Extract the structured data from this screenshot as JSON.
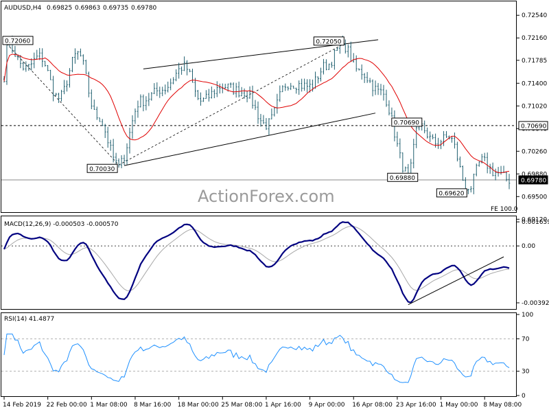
{
  "chart_data": [
    {
      "type": "candlestick",
      "title": "AUDUSD,H4",
      "ohlc_readout": [
        "0.69825",
        "0.69863",
        "0.69735",
        "0.69780"
      ],
      "watermark": "ActionForex.com",
      "ylim": [
        0.6925,
        0.7275
      ],
      "y_tick_labels": [
        "0.72540",
        "0.72160",
        "0.71785",
        "0.71400",
        "0.71020",
        "0.70640",
        "0.70260",
        "0.69880",
        "0.69500",
        "0.69120"
      ],
      "y_ticks": [
        0.7254,
        0.7216,
        0.71785,
        0.714,
        0.7102,
        0.7064,
        0.7026,
        0.6988,
        0.695,
        0.6912
      ],
      "current_price": {
        "value": 0.6978,
        "label": "0.69780"
      },
      "horizontal_level": {
        "value": 0.7069,
        "label": "0.70690"
      },
      "fe_label": "FE 100.0",
      "annotations": [
        {
          "label": "0.72060",
          "value": 0.7206
        },
        {
          "label": "0.70030",
          "value": 0.7003
        },
        {
          "label": "0.72050",
          "value": 0.7205
        },
        {
          "label": "0.70690",
          "value": 0.7069
        },
        {
          "label": "0.69880",
          "value": 0.6988
        },
        {
          "label": "0.69620",
          "value": 0.6962
        }
      ],
      "swing_points": [
        {
          "bar": 1,
          "value": 0.7206
        },
        {
          "bar": 42,
          "value": 0.7003
        },
        {
          "bar": 124,
          "value": 0.7205
        },
        {
          "bar": 148,
          "value": 0.6988
        },
        {
          "bar": 152,
          "value": 0.7069
        },
        {
          "bar": 170,
          "value": 0.6962
        }
      ],
      "channel": {
        "upper": [
          {
            "bar": 51,
            "value": 0.7164
          },
          {
            "bar": 137,
            "value": 0.7213
          }
        ],
        "lower": [
          {
            "bar": 44,
            "value": 0.7002
          },
          {
            "bar": 136,
            "value": 0.709
          }
        ]
      },
      "moving_average_color": "#e00000",
      "candle_color": "#1f5f6f",
      "x_tick_labels": [
        "14 Feb 2019",
        "22 Feb 00:00",
        "1 Mar 08:00",
        "8 Mar 16:00",
        "18 Mar 00:00",
        "25 Mar 08:00",
        "1 Apr 16:00",
        "9 Apr 00:00",
        "16 Apr 08:00",
        "23 Apr 16:00",
        "1 May 00:00",
        "8 May 08:00"
      ],
      "x_tick_bars": [
        0,
        16,
        32,
        48,
        64,
        80,
        96,
        112,
        128,
        144,
        160,
        176
      ]
    },
    {
      "type": "line",
      "title": "MACD(12,26,9) -0.000503 -0.000570",
      "ylim": [
        -0.0043,
        0.0019
      ],
      "y_tick_labels": [
        "0.001659",
        "0.00",
        "-0.003922"
      ],
      "y_ticks": [
        0.001659,
        0.0,
        -0.003922
      ],
      "current_label": "0.00",
      "series": [
        {
          "name": "MACD",
          "color": "#000080"
        },
        {
          "name": "Signal",
          "color": "#a8a8a8"
        }
      ],
      "trendline": [
        {
          "bar": 148,
          "value": -0.00405
        },
        {
          "bar": 183,
          "value": -0.00075
        }
      ]
    },
    {
      "type": "line",
      "title": "RSI(14) 41.4877",
      "ylim": [
        0,
        100
      ],
      "y_tick_labels": [
        "100",
        "70",
        "30",
        "0"
      ],
      "y_ticks": [
        100,
        70,
        30,
        0
      ],
      "levels": [
        70,
        30
      ],
      "series": [
        {
          "name": "RSI",
          "color": "#1e90ff"
        }
      ]
    }
  ]
}
